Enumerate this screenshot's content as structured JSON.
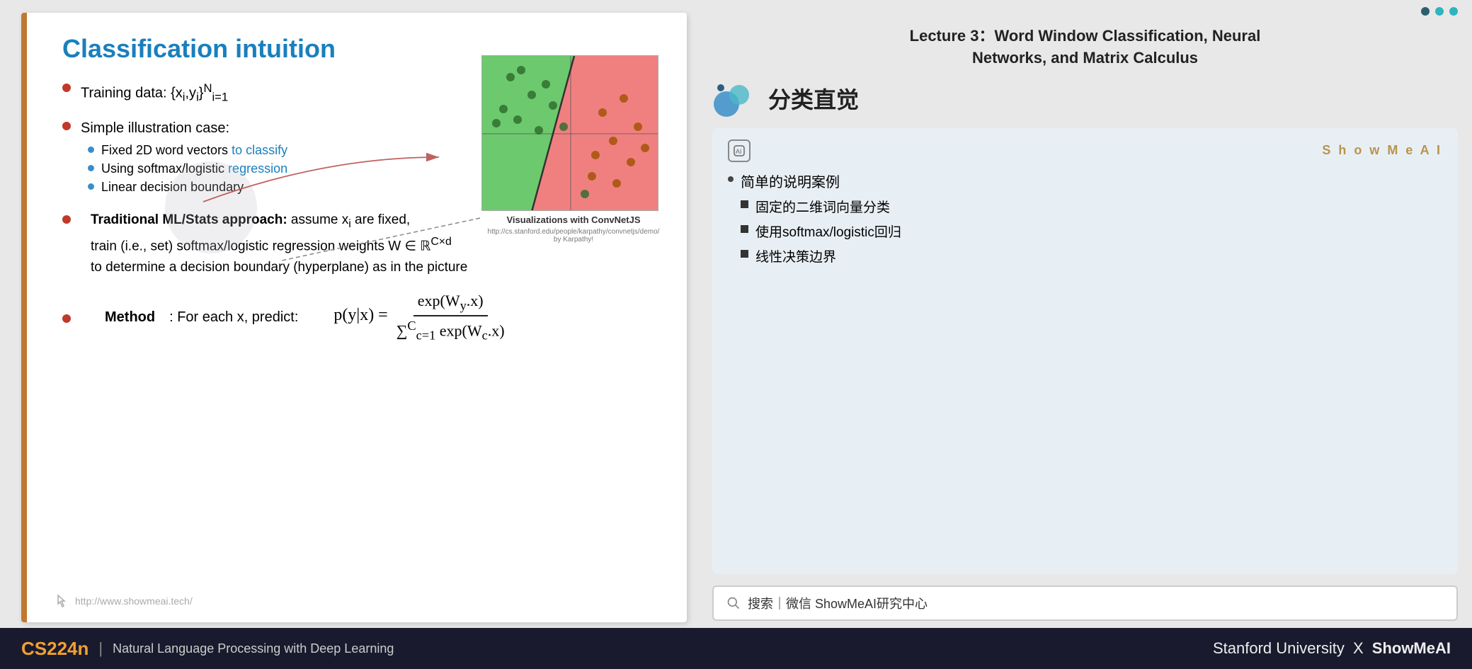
{
  "slide": {
    "title": "Classification intuition",
    "bullets": [
      {
        "id": "training",
        "text": "Training data: {x",
        "sub_i": "i",
        "text2": ",y",
        "sub_y": "i",
        "text3": "}",
        "sup": "N",
        "sub_n": "i=1"
      },
      {
        "id": "illustration",
        "text": "Simple illustration case:",
        "subitems": [
          {
            "text": "Fixed 2D word vectors ",
            "highlight": "to classify"
          },
          {
            "text": "Using softmax/logistic ",
            "highlight": "regression"
          },
          {
            "text": "Linear decision boundary"
          }
        ]
      },
      {
        "id": "ml_approach",
        "bold_start": "Traditional ML/Stats approach:",
        "text": " assume x",
        "sub": "i",
        "text2": " are fixed, train (i.e., set) softmax/logistic regression weights W ∈ ℝ",
        "sup": "C×d",
        "text3": " to determine a decision boundary (hyperplane) as in the picture"
      },
      {
        "id": "method",
        "bold": "Method",
        "text": ": For each x, predict:"
      }
    ],
    "formula": "p(y|x) = exp(W_y · x) / Σ_{c=1}^{C} exp(W_c · x)",
    "viz_caption": "Visualizations with ConvNetJS",
    "viz_link": "http://cs.stanford.edu/people/karpathy/convnetjs/demo/",
    "viz_link2": "by Karpathy!",
    "watermark_url": "http://www.showmeai.tech/"
  },
  "right": {
    "lecture_title_line1": "Lecture 3：Word Window Classification, Neural",
    "lecture_title_line2": "Networks, and Matrix Calculus",
    "chinese_title": "分类直觉",
    "ai_brand": "S h o w M e A I",
    "cn_bullets": {
      "main": "简单的说明案例",
      "subitems": [
        "固定的二维词向量分类",
        "使用softmax/logistic回归",
        "线性决策边界"
      ]
    },
    "search_text": "搜索｜微信 ShowMeAI研究中心"
  },
  "footer": {
    "course": "CS224n",
    "separator": "|",
    "description": "Natural Language Processing with Deep Learning",
    "university": "Stanford University",
    "x": "X",
    "brand": "ShowMeAI"
  },
  "colors": {
    "accent_orange": "#f0a030",
    "slide_border": "#c07830",
    "title_blue": "#1a7fbd",
    "footer_bg": "#1a1a2e"
  }
}
